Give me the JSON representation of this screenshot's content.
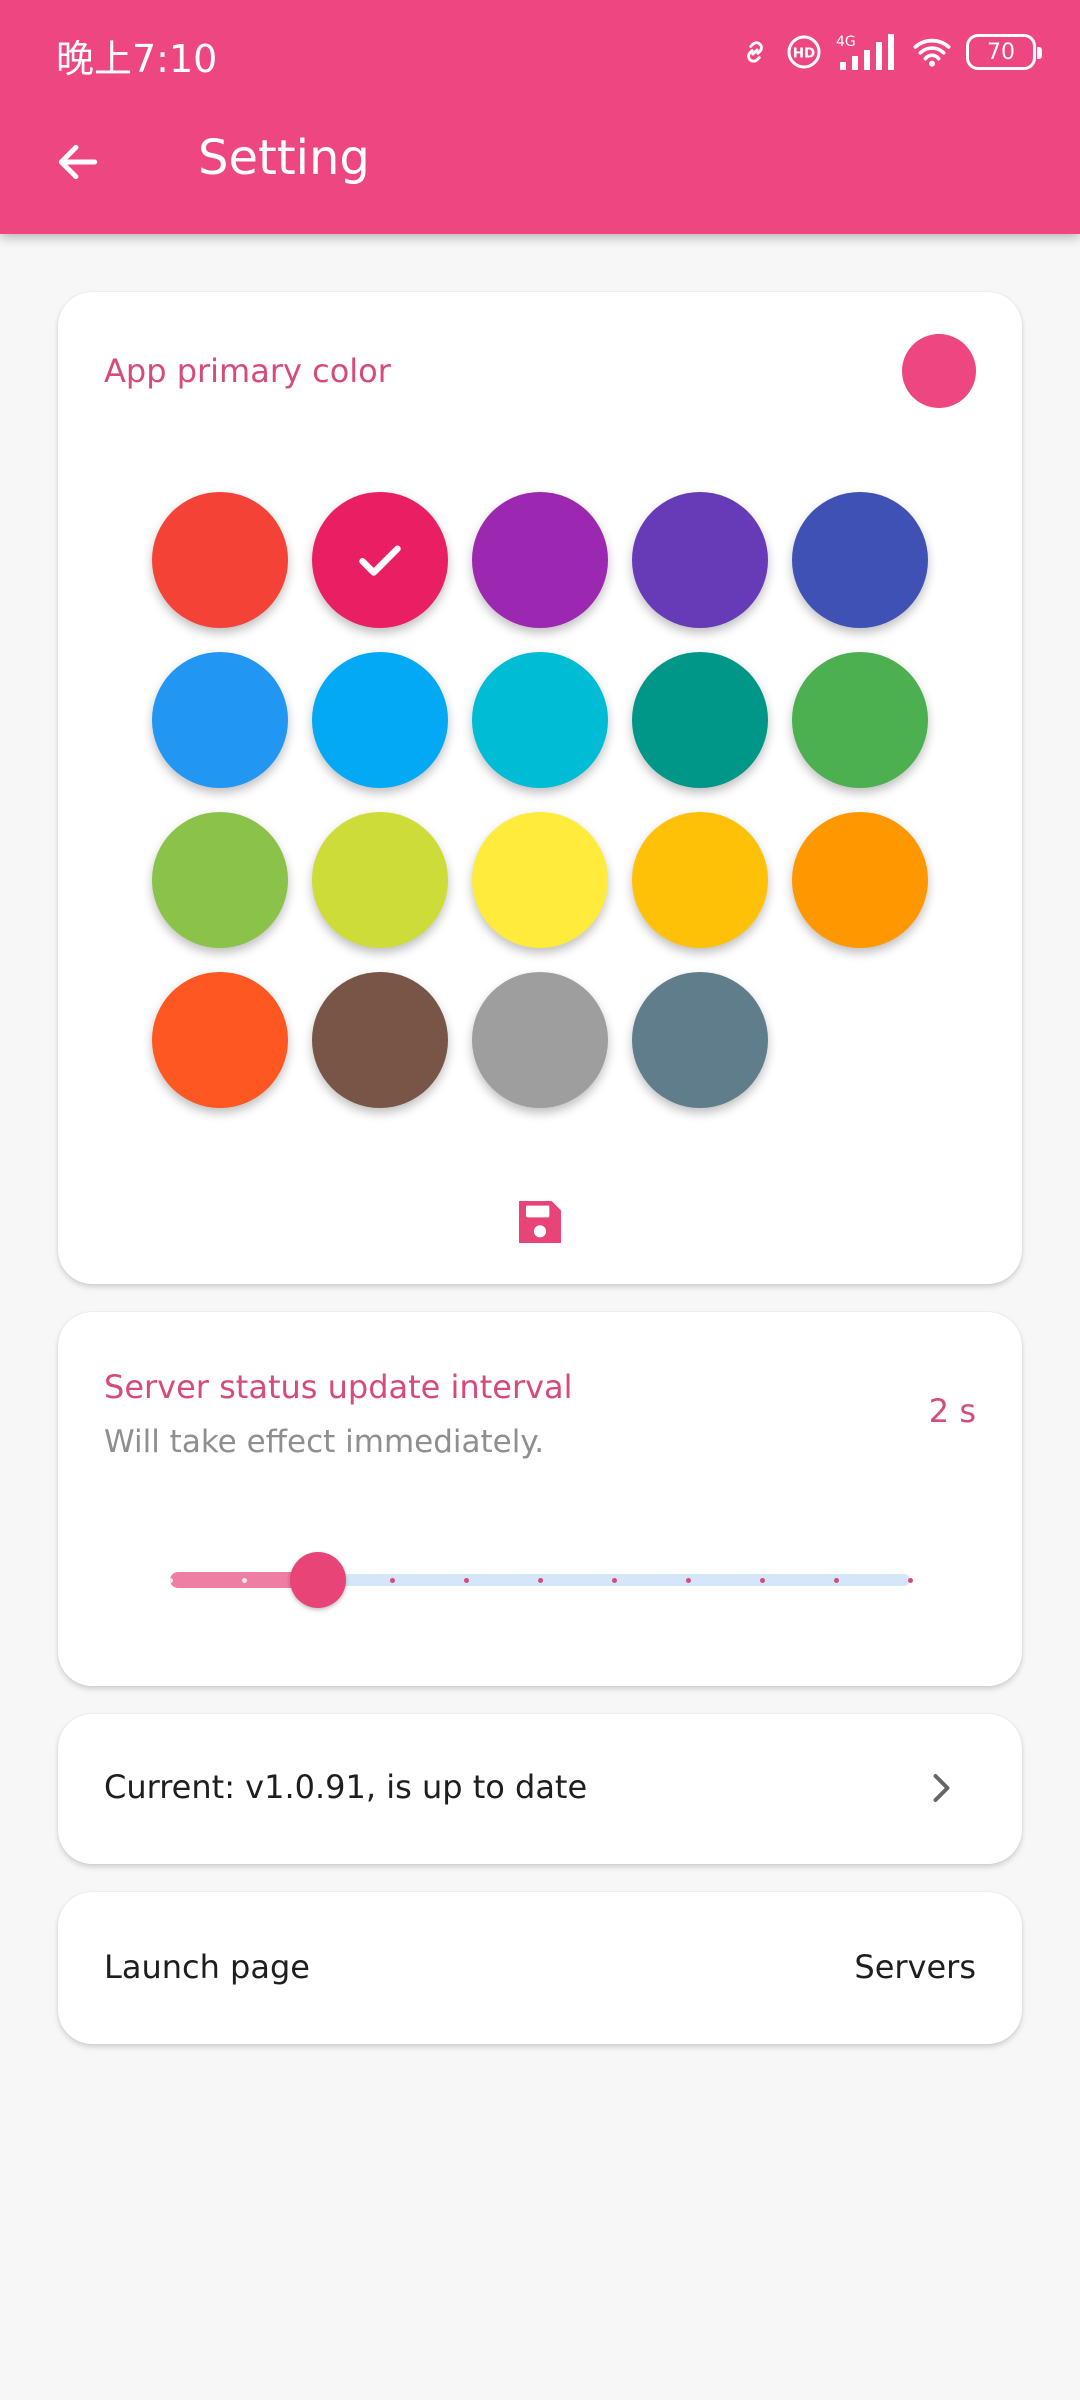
{
  "status_bar": {
    "time": "晚上7:10",
    "battery": "70"
  },
  "appbar": {
    "title": "Setting"
  },
  "colors": {
    "primary": "#ed4680",
    "swatches": [
      "#f44336",
      "#e91e63",
      "#9c27b0",
      "#673ab7",
      "#3f51b5",
      "#2196f3",
      "#03a9f4",
      "#00bcd4",
      "#009688",
      "#4caf50",
      "#8bc34a",
      "#cddc39",
      "#ffeb3b",
      "#ffc107",
      "#ff9800",
      "#ff5722",
      "#795548",
      "#9e9e9e",
      "#607d8b"
    ],
    "selected_index": 1
  },
  "color_card": {
    "title": "App primary color"
  },
  "interval_card": {
    "title": "Server status update interval",
    "subtitle": "Will take effect immediately.",
    "value": "2 s",
    "slider": {
      "value": 2,
      "min": 0,
      "max": 10
    }
  },
  "version_card": {
    "text": "Current: v1.0.91, is up to date"
  },
  "launch_card": {
    "label": "Launch page",
    "value": "Servers"
  }
}
